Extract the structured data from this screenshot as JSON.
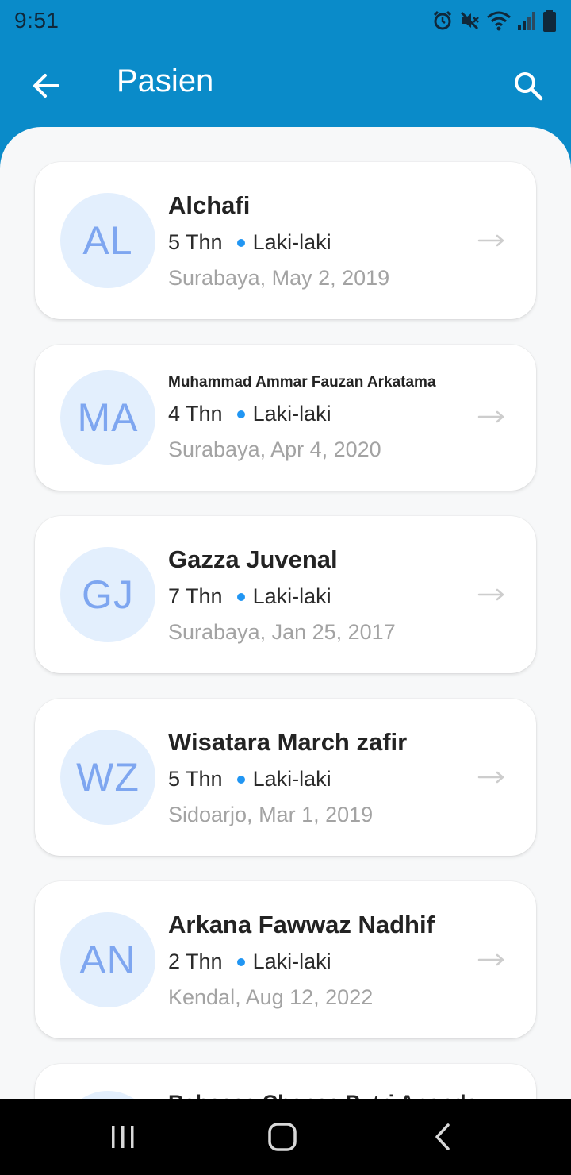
{
  "status_bar": {
    "time": "9:51"
  },
  "app_bar": {
    "title": "Pasien"
  },
  "patients": [
    {
      "initials": "AL",
      "name": "Alchafi",
      "age": "5 Thn",
      "gender": "Laki-laki",
      "place_date": "Surabaya, May 2, 2019"
    },
    {
      "initials": "MA",
      "name": "Muhammad Ammar Fauzan Arkatama",
      "age": "4 Thn",
      "gender": "Laki-laki",
      "place_date": "Surabaya, Apr 4, 2020"
    },
    {
      "initials": "GJ",
      "name": "Gazza Juvenal",
      "age": "7 Thn",
      "gender": "Laki-laki",
      "place_date": "Surabaya, Jan 25, 2017"
    },
    {
      "initials": "WZ",
      "name": "Wisatara March zafir",
      "age": "5 Thn",
      "gender": "Laki-laki",
      "place_date": "Sidoarjo, Mar 1, 2019"
    },
    {
      "initials": "AN",
      "name": "Arkana Fawwaz Nadhif",
      "age": "2 Thn",
      "gender": "Laki-laki",
      "place_date": "Kendal, Aug 12, 2022"
    },
    {
      "initials": "",
      "name": "Raheesa Chanee Putri Ananda",
      "age": "",
      "gender": "",
      "place_date": ""
    }
  ],
  "colors": {
    "primary": "#0a8bc9",
    "accent_dot": "#2196f3",
    "avatar_bg": "#e3effd",
    "avatar_text": "#7ea6f0"
  },
  "icons": {
    "back": "arrow-left-icon",
    "search": "search-icon",
    "row_arrow": "arrow-right-icon"
  }
}
